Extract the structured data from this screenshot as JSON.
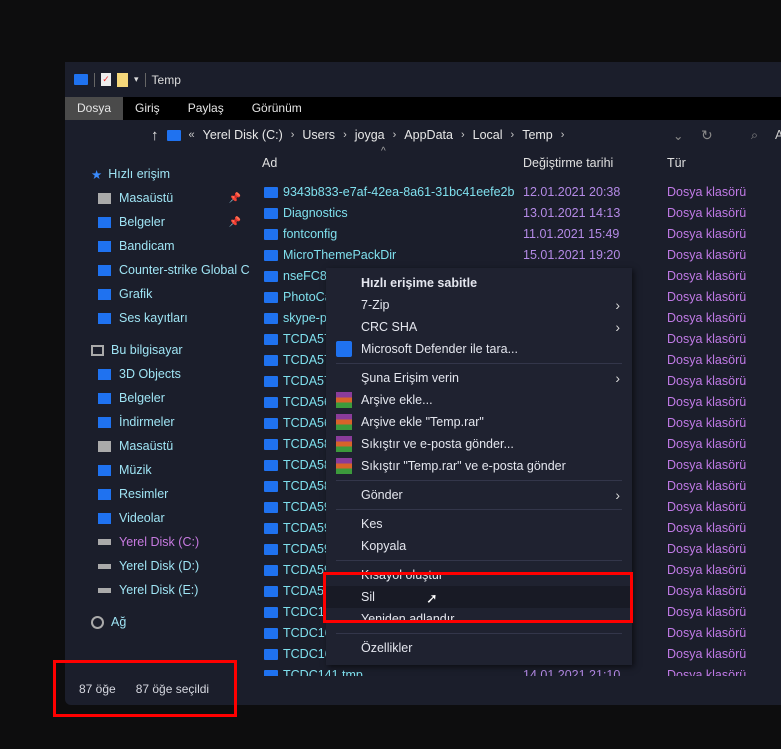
{
  "title": "Temp",
  "ribbon": [
    "Dosya",
    "Giriş",
    "Paylaş",
    "Görünüm"
  ],
  "breadcrumb": [
    "Yerel Disk (C:)",
    "Users",
    "joyga",
    "AppData",
    "Local",
    "Temp"
  ],
  "search_placeholder": "A",
  "sidebar": {
    "quick": "Hızlı erişim",
    "quick_items": [
      {
        "label": "Masaüstü",
        "pinned": true
      },
      {
        "label": "Belgeler",
        "pinned": true
      },
      {
        "label": "Bandicam"
      },
      {
        "label": "Counter-strike  Global C"
      },
      {
        "label": "Grafik"
      },
      {
        "label": "Ses kayıtları"
      }
    ],
    "pc": "Bu bilgisayar",
    "pc_items": [
      "3D Objects",
      "Belgeler",
      "İndirmeler",
      "Masaüstü",
      "Müzik",
      "Resimler",
      "Videolar",
      "Yerel Disk (C:)",
      "Yerel Disk (D:)",
      "Yerel Disk (E:)"
    ],
    "network": "Ağ"
  },
  "columns": {
    "name": "Ad",
    "date": "Değiştirme tarihi",
    "type": "Tür"
  },
  "rows": [
    {
      "name": "9343b833-e7af-42ea-8a61-31bc41eefe2b",
      "date": "12.01.2021 20:38",
      "type": "Dosya klasörü"
    },
    {
      "name": "Diagnostics",
      "date": "13.01.2021 14:13",
      "type": "Dosya klasörü"
    },
    {
      "name": "fontconfig",
      "date": "11.01.2021 15:49",
      "type": "Dosya klasörü"
    },
    {
      "name": "MicroThemePackDir",
      "date": "15.01.2021 19:20",
      "type": "Dosya klasörü"
    },
    {
      "name": "nseFC81",
      "type": "Dosya klasörü"
    },
    {
      "name": "PhotoCa",
      "type": "Dosya klasörü"
    },
    {
      "name": "skype-p",
      "type": "Dosya klasörü"
    },
    {
      "name": "TCDA57",
      "type": "Dosya klasörü"
    },
    {
      "name": "TCDA57",
      "type": "Dosya klasörü"
    },
    {
      "name": "TCDA57",
      "type": "Dosya klasörü"
    },
    {
      "name": "TCDA56",
      "type": "Dosya klasörü"
    },
    {
      "name": "TCDA56",
      "type": "Dosya klasörü"
    },
    {
      "name": "TCDA58",
      "type": "Dosya klasörü"
    },
    {
      "name": "TCDA58",
      "type": "Dosya klasörü"
    },
    {
      "name": "TCDA58",
      "type": "Dosya klasörü"
    },
    {
      "name": "TCDA59",
      "type": "Dosya klasörü"
    },
    {
      "name": "TCDA59",
      "type": "Dosya klasörü"
    },
    {
      "name": "TCDA59",
      "type": "Dosya klasörü"
    },
    {
      "name": "TCDA59",
      "type": "Dosya klasörü"
    },
    {
      "name": "TCDA59",
      "type": "Dosya klasörü"
    },
    {
      "name": "TCDC15",
      "type": "Dosya klasörü"
    },
    {
      "name": "TCDC16",
      "type": "Dosya klasörü"
    },
    {
      "name": "TCDC16",
      "type": "Dosya klasörü"
    },
    {
      "name": "TCDC141.tmp",
      "date": "14.01.2021 21:10",
      "type": "Dosya klasörü"
    }
  ],
  "status": {
    "count": "87 öğe",
    "selected": "87 öğe seçildi"
  },
  "menu": {
    "pin": "Hızlı erişime sabitle",
    "zip": "7-Zip",
    "crc": "CRC SHA",
    "defender": "Microsoft Defender ile tara...",
    "access": "Şuna Erişim verin",
    "archive": "Arşive ekle...",
    "archive_rar": "Arşive ekle \"Temp.rar\"",
    "compress_mail": "Sıkıştır ve e-posta gönder...",
    "compress_rar_mail": "Sıkıştır \"Temp.rar\" ve e-posta gönder",
    "send": "Gönder",
    "cut": "Kes",
    "copy": "Kopyala",
    "shortcut": "Kısayol oluştur",
    "delete": "Sil",
    "rename": "Yeniden adlandır",
    "props": "Özellikler"
  },
  "colors": {
    "highlight": "#ff0000",
    "folder": "#1f72f0"
  }
}
